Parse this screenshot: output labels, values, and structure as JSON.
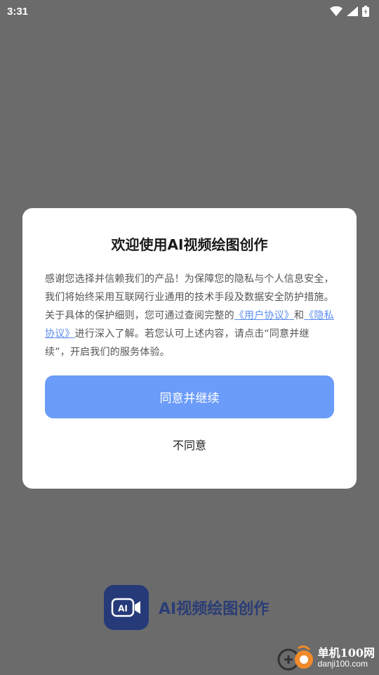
{
  "status_bar": {
    "time": "3:31",
    "icons": [
      "wifi-icon",
      "signal-icon",
      "battery-icon"
    ]
  },
  "dialog": {
    "title": "欢迎使用AI视频绘图创作",
    "body_text_1": "感谢您选择并信赖我们的产品！为保障您的隐私与个人信息安全，我们将始终采用互联网行业通用的技术手段及数据安全防护措施。关于具体的保护细则，您可通过查阅完整的",
    "user_agreement_link": "《用户协议》",
    "body_text_2": "和",
    "privacy_link": "《隐私协议》",
    "body_text_3": "进行深入了解。若您认可上述内容，请点击“同意并继续”，开启我们的服务体验。",
    "agree_button": "同意并继续",
    "disagree_button": "不同意"
  },
  "brand": {
    "logo_text": "AI",
    "name": "AI视频绘图创作"
  },
  "watermark": {
    "title": "单机100网",
    "url": "danji100.com"
  },
  "colors": {
    "overlay": "#6b6b6b",
    "dialog_bg": "#ffffff",
    "accent_button": "#6b9cfa",
    "link": "#5b8def",
    "brand_dark": "#263a7a"
  }
}
